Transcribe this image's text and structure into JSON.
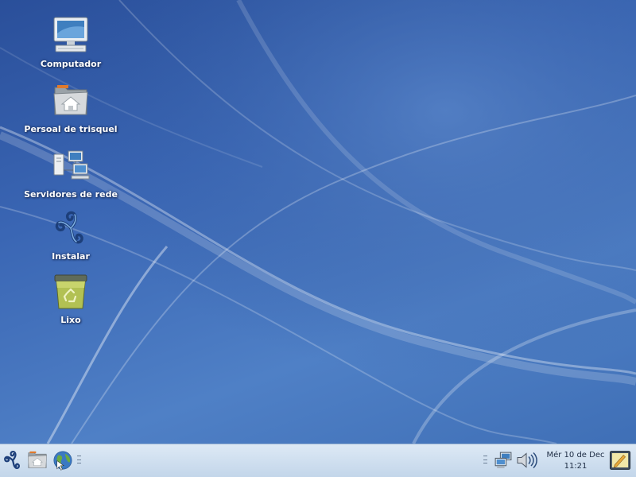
{
  "desktop": {
    "icons": [
      {
        "label": "Computador",
        "icon": "computer-icon"
      },
      {
        "label": "Persoal de trisquel",
        "icon": "home-folder-icon"
      },
      {
        "label": "Servidores de rede",
        "icon": "network-servers-icon"
      },
      {
        "label": "Instalar",
        "icon": "trisquel-install-icon"
      },
      {
        "label": "Lixo",
        "icon": "trash-icon"
      }
    ],
    "wallpaper_colors": {
      "base": "#3a66b4",
      "dark": "#2a4f9a",
      "light": "#4f80c6"
    }
  },
  "panel": {
    "launchers": [
      {
        "icon": "trisquel-menu-icon"
      },
      {
        "icon": "home-folder-icon"
      },
      {
        "icon": "web-browser-icon"
      }
    ],
    "tray": [
      {
        "icon": "network-status-icon"
      },
      {
        "icon": "volume-icon"
      }
    ],
    "clock": {
      "date": "Mér 10 de Dec",
      "time": "11:21"
    },
    "show_desktop_icon": "show-desktop-icon"
  }
}
